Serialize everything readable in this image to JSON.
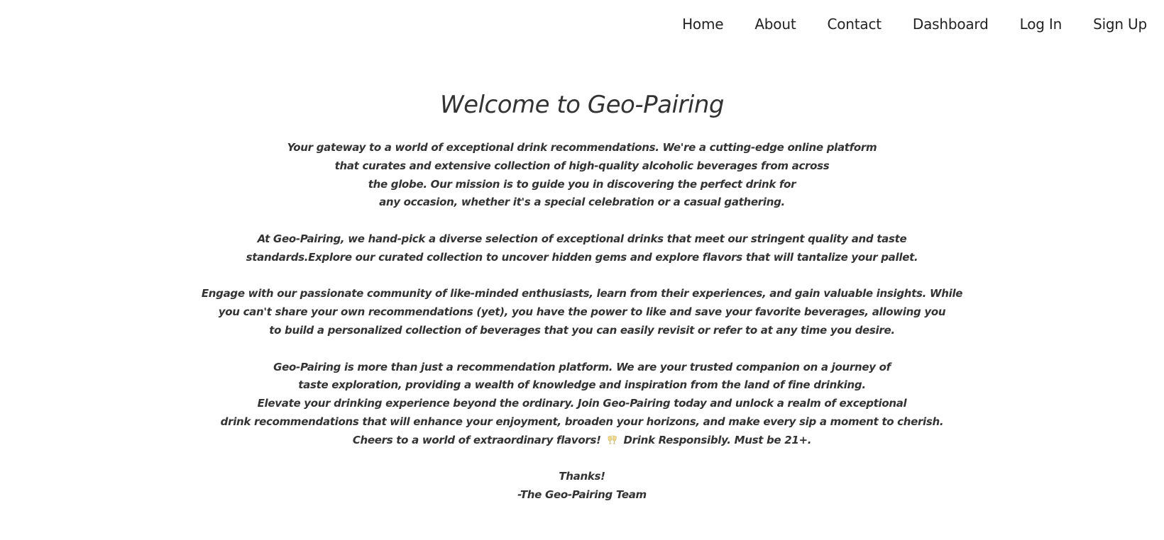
{
  "nav": {
    "items": [
      {
        "label": "Home"
      },
      {
        "label": "About"
      },
      {
        "label": "Contact"
      },
      {
        "label": "Dashboard"
      },
      {
        "label": "Log In"
      },
      {
        "label": "Sign Up"
      }
    ]
  },
  "main": {
    "title": "Welcome to Geo-Pairing",
    "paragraphs": [
      [
        "Your gateway to a world of exceptional drink recommendations. We're a cutting-edge online platform",
        "that curates and extensive collection of high-quality alcoholic beverages from across",
        "the globe. Our mission is to guide you in discovering the perfect drink for",
        "any occasion, whether it's a special celebration or a casual gathering."
      ],
      [
        "At Geo-Pairing, we hand-pick a diverse selection of exceptional drinks that meet our stringent quality and taste",
        "standards.Explore our curated collection to uncover hidden gems and explore flavors that will tantalize your pallet."
      ],
      [
        "Engage with our passionate community of like-minded enthusiasts, learn from their experiences, and gain valuable insights. While",
        "you can't share your own recommendations (yet), you have the power to like and save your favorite beverages, allowing you",
        "to build a personalized collection of beverages that you can easily revisit or refer to at any time you desire."
      ],
      [
        "Geo-Pairing is more than just a recommendation platform. We are your trusted companion on a journey of",
        "taste exploration, providing a wealth of knowledge and inspiration from the land of fine drinking.",
        "Elevate your drinking experience beyond the ordinary. Join Geo-Pairing today and unlock a realm of exceptional",
        "drink recommendations that will enhance your enjoyment, broaden your horizons, and make every sip a moment to cherish."
      ]
    ],
    "cheers": {
      "before": "Cheers to a world of extraordinary flavors!",
      "icon": "clinking-glasses-icon",
      "after": "Drink Responsibly. Must be 21+."
    },
    "signoff": [
      "Thanks!",
      "-The Geo-Pairing Team"
    ]
  }
}
